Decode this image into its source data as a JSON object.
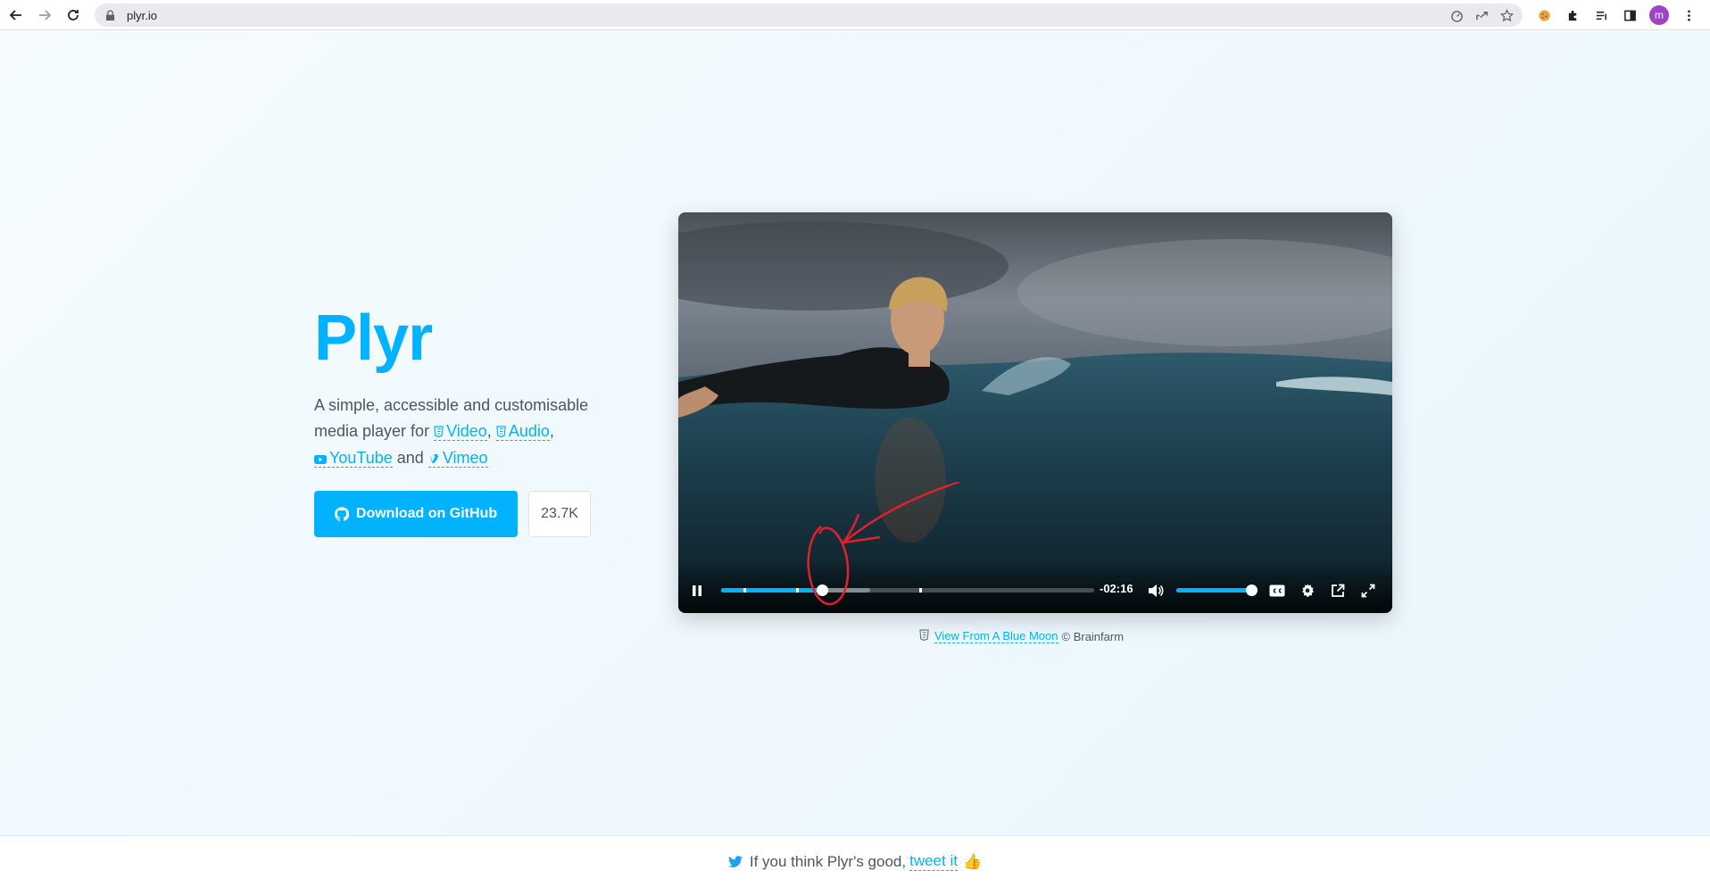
{
  "browser": {
    "url": "plyr.io",
    "profile_initial": "m"
  },
  "page": {
    "title": "Plyr",
    "tagline_prefix": "A simple, accessible and customisable media player for",
    "links": {
      "video": "Video",
      "audio": "Audio",
      "youtube": "YouTube",
      "vimeo": "Vimeo"
    },
    "sep_comma": ",",
    "sep_and": "and",
    "github_button": "Download on GitHub",
    "github_stars": "23.7K"
  },
  "player": {
    "time_remaining": "-02:16",
    "progress_fraction": 0.27,
    "buffer_fraction": 0.4,
    "volume_fraction": 1.0,
    "markers_fraction": [
      0.06,
      0.2,
      0.53
    ]
  },
  "caption": {
    "link": "View From A Blue Moon",
    "credit": "© Brainfarm"
  },
  "footer": {
    "text": "If you think Plyr's good,",
    "link": "tweet it",
    "emoji": "👍"
  },
  "colors": {
    "accent": "#00b2ff",
    "text": "#4a5764",
    "annotation": "#e0202a"
  }
}
